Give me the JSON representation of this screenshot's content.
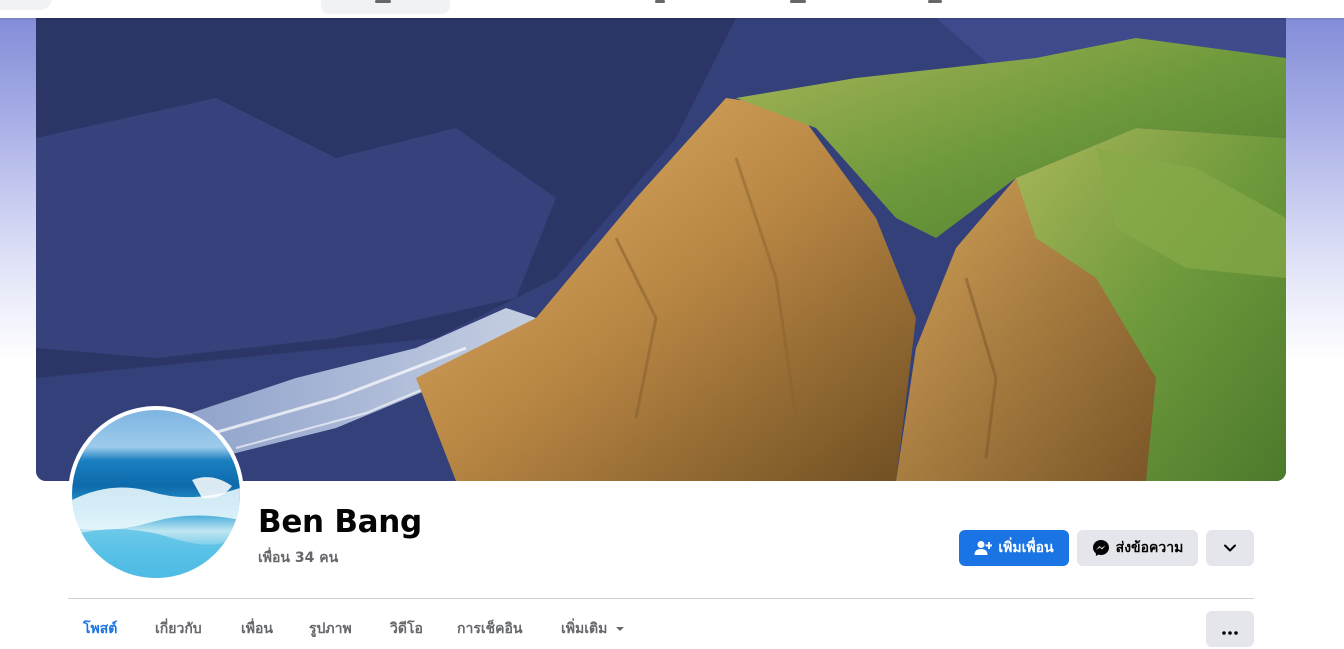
{
  "profile": {
    "name": "Ben Bang",
    "friends_text": "เพื่อน 34 คน"
  },
  "actions": {
    "add_friend_label": "เพิ่มเพื่อน",
    "message_label": "ส่งข้อความ"
  },
  "tabs": [
    {
      "label": "โพสต์",
      "active": true
    },
    {
      "label": "เกี่ยวกับ",
      "active": false
    },
    {
      "label": "เพื่อน",
      "active": false
    },
    {
      "label": "รูปภาพ",
      "active": false
    },
    {
      "label": "วิดีโอ",
      "active": false
    },
    {
      "label": "การเช็คอิน",
      "active": false
    },
    {
      "label": "เพิ่มเติม",
      "active": false
    }
  ],
  "icons": {
    "add_friend": "person-plus-icon",
    "message": "messenger-icon",
    "dropdown": "chevron-down-icon",
    "tab_more_caret": "caret-down-icon",
    "overflow": "more-dots-icon"
  },
  "colors": {
    "accent": "#1b74e4",
    "secondary_button": "#e4e6eb",
    "text_primary": "#050505",
    "text_secondary": "#65676b"
  }
}
